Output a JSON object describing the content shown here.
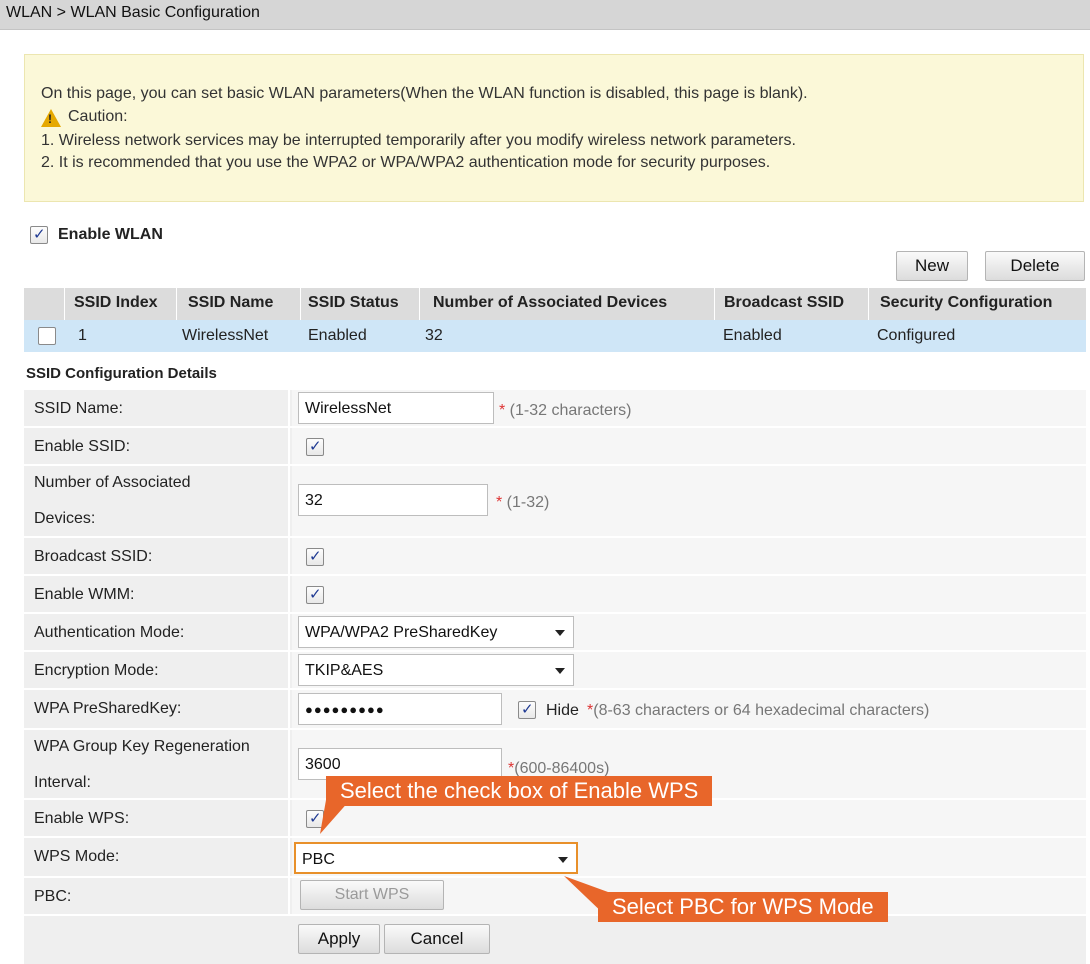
{
  "breadcrumb": "WLAN > WLAN Basic Configuration",
  "notice": {
    "intro": "On this page, you can set basic WLAN parameters(When the WLAN function is disabled, this page is blank).",
    "caution_label": "Caution:",
    "line1": "1. Wireless network services may be interrupted temporarily after you modify wireless network parameters.",
    "line2": "2. It is recommended that you use the WPA2 or WPA/WPA2 authentication mode for security purposes."
  },
  "enable_wlan": {
    "label": "Enable WLAN",
    "checked": true
  },
  "buttons": {
    "new": "New",
    "delete": "Delete",
    "apply": "Apply",
    "cancel": "Cancel",
    "start_wps": "Start WPS"
  },
  "table": {
    "columns": [
      "SSID Index",
      "SSID Name",
      "SSID Status",
      "Number of Associated Devices",
      "Broadcast SSID",
      "Security Configuration"
    ],
    "rows": [
      {
        "index": "1",
        "name": "WirelessNet",
        "status": "Enabled",
        "devices": "32",
        "broadcast": "Enabled",
        "security": "Configured"
      }
    ]
  },
  "details": {
    "title": "SSID Configuration Details",
    "ssid_name": {
      "label": "SSID Name:",
      "value": "WirelessNet",
      "hint": "(1-32 characters)"
    },
    "enable_ssid": {
      "label": "Enable SSID:",
      "checked": true
    },
    "num_devices": {
      "label_line1": "Number of Associated",
      "label_line2": "Devices:",
      "value": "32",
      "hint": "(1-32)"
    },
    "broadcast_ssid": {
      "label": "Broadcast SSID:",
      "checked": true
    },
    "enable_wmm": {
      "label": "Enable WMM:",
      "checked": true
    },
    "auth_mode": {
      "label": "Authentication Mode:",
      "value": "WPA/WPA2 PreSharedKey"
    },
    "encryption_mode": {
      "label": "Encryption Mode:",
      "value": "TKIP&AES"
    },
    "psk": {
      "label": "WPA PreSharedKey:",
      "value": "●●●●●●●●●",
      "hide_label": "Hide",
      "hide_checked": true,
      "hint": "(8-63 characters or 64 hexadecimal characters)"
    },
    "group_key": {
      "label_line1": "WPA Group Key Regeneration",
      "label_line2": "Interval:",
      "value": "3600",
      "hint": "(600-86400s)"
    },
    "enable_wps": {
      "label": "Enable WPS:",
      "checked": true
    },
    "wps_mode": {
      "label": "WPS Mode:",
      "value": "PBC"
    },
    "pbc": {
      "label": "PBC:"
    }
  },
  "callouts": {
    "enable_wps": "Select the check box of Enable WPS",
    "wps_mode": "Select PBC for WPS Mode"
  },
  "colors": {
    "callout": "#e8662a",
    "selected_row": "#cfe6f7",
    "notice_bg": "#fbf8d8"
  }
}
